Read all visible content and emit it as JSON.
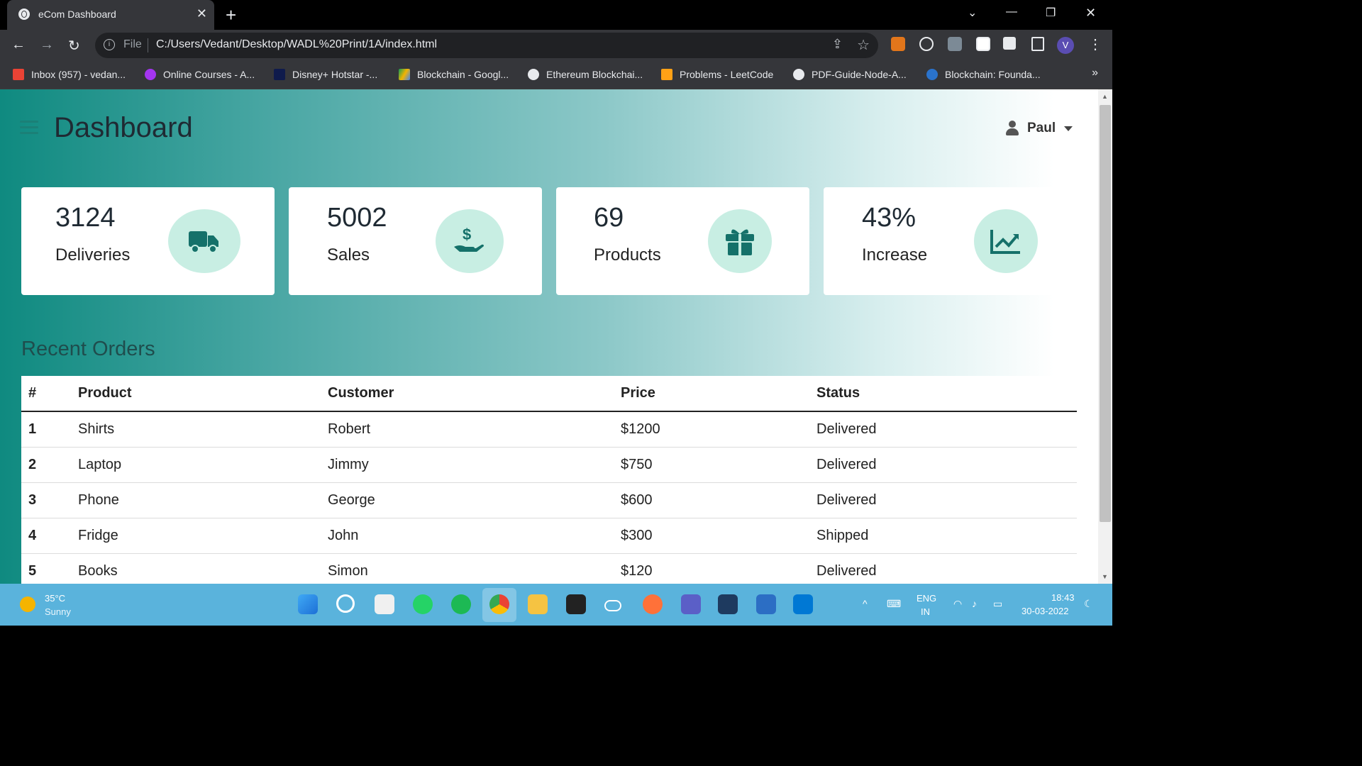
{
  "browser": {
    "tab_title": "eCom Dashboard",
    "file_label": "File",
    "url": "C:/Users/Vedant/Desktop/WADL%20Print/1A/index.html",
    "profile_initial": "V",
    "bookmarks": [
      "Inbox (957) - vedan...",
      "Online Courses - A...",
      "Disney+ Hotstar -...",
      "Blockchain - Googl...",
      "Ethereum Blockchai...",
      "Problems - LeetCode",
      "PDF-Guide-Node-A...",
      "Blockchain: Founda..."
    ],
    "bookmarks_more": "»"
  },
  "header": {
    "title": "Dashboard",
    "user_name": "Paul"
  },
  "cards": [
    {
      "value": "3124",
      "label": "Deliveries",
      "icon": "truck-icon"
    },
    {
      "value": "5002",
      "label": "Sales",
      "icon": "dollar-hand-icon"
    },
    {
      "value": "69",
      "label": "Products",
      "icon": "gift-icon"
    },
    {
      "value": "43%",
      "label": "Increase",
      "icon": "chart-icon"
    }
  ],
  "orders": {
    "title": "Recent Orders",
    "columns": [
      "#",
      "Product",
      "Customer",
      "Price",
      "Status"
    ],
    "rows": [
      [
        "1",
        "Shirts",
        "Robert",
        "$1200",
        "Delivered"
      ],
      [
        "2",
        "Laptop",
        "Jimmy",
        "$750",
        "Delivered"
      ],
      [
        "3",
        "Phone",
        "George",
        "$600",
        "Delivered"
      ],
      [
        "4",
        "Fridge",
        "John",
        "$300",
        "Shipped"
      ],
      [
        "5",
        "Books",
        "Simon",
        "$120",
        "Delivered"
      ]
    ]
  },
  "taskbar": {
    "temperature": "35°C",
    "condition": "Sunny",
    "lang_line1": "ENG",
    "lang_line2": "IN",
    "time": "18:43",
    "date": "30-03-2022"
  },
  "colors": {
    "accent": "#1b8077",
    "icon_circle": "#c8eee3",
    "taskbar": "#5ab3dc"
  }
}
